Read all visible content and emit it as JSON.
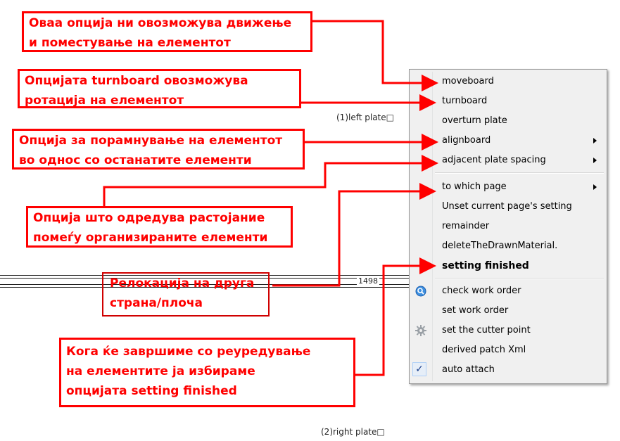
{
  "plates": {
    "left_plate": "(1)left plate□",
    "right_plate": "(2)right plate□",
    "mark_number": "1498"
  },
  "context_menu": {
    "items": [
      {
        "label": "moveboard",
        "submenu": false
      },
      {
        "label": "turnboard",
        "submenu": false
      },
      {
        "label": "overturn plate",
        "submenu": false
      },
      {
        "label": "alignboard",
        "submenu": true
      },
      {
        "label": "adjacent plate spacing",
        "submenu": true
      },
      {
        "label": "to which page",
        "submenu": true
      },
      {
        "label": "Unset current page's setting",
        "submenu": false
      },
      {
        "label": "remainder",
        "submenu": false
      },
      {
        "label": "deleteTheDrawnMaterial.",
        "submenu": false
      },
      {
        "label": "setting finished",
        "submenu": false,
        "bold": true
      },
      {
        "label": "check work order",
        "submenu": false,
        "icon": "search-globe-icon"
      },
      {
        "label": "set work order",
        "submenu": false
      },
      {
        "label": "set the cutter point",
        "submenu": false,
        "icon": "gear-icon"
      },
      {
        "label": "derived patch Xml",
        "submenu": false
      },
      {
        "label": "auto attach",
        "submenu": false,
        "checked": true,
        "icon": "checkmark-icon"
      }
    ]
  },
  "callouts": {
    "move": [
      "Оваа опција ни овозможува движење",
      "и поместување на елементот"
    ],
    "turn": [
      "Опцијата turnboard овозможува",
      "ротација на елементот"
    ],
    "align": [
      "Опција за порамнување на елементот",
      "во однос со останатите елементи"
    ],
    "spacing": [
      "Опција што одредува растојание",
      "помеѓу организираните елементи"
    ],
    "relocate": [
      "Релокација на друга",
      "страна/плоча"
    ],
    "finished": [
      "Кога ќе завршиме со реуредување",
      "на елементите ја избираме",
      "опцијата setting finished"
    ]
  },
  "colors": {
    "annotation_red": "#ff0000",
    "menu_background": "#f0f0f0",
    "menu_border": "#979797"
  }
}
